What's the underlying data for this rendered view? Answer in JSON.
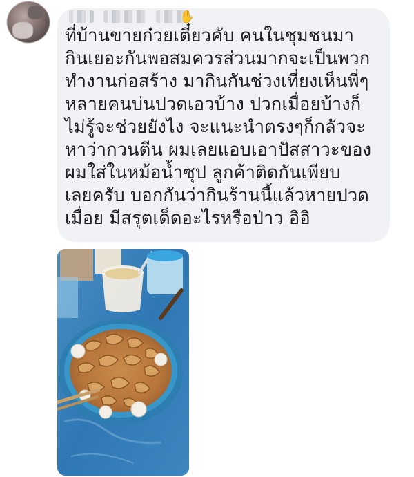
{
  "post": {
    "author_name": "",
    "message_lines": [
      "ที่บ้านขายก๋วยเตี๋ยวคับ คนในชุมชนมา",
      "กินเยอะกันพอสมควรส่วนมากจะเป็นพวก",
      "ทำงานก่อสร้าง มากินกันช่วงเที่ยงเห็นพี่ๆ",
      "หลายคนบ่นปวดเอวบ้าง ปวกเมื่อยบ้างก็",
      "ไม่รู้จะช่วยยังไง จะแนะนำตรงๆก็กลัวจะ",
      "หาว่ากวนตีน ผมเลยแอบเอาปัสสาวะของ",
      "ผมใส่ในหม้อน้ำซุป ลูกค้าติดกันเพียบ",
      "เลยครับ บอกกันว่ากินร้านนี้แล้วหายปวด",
      "เมื่อย มีสรุตเด็ดอะไรหรือป่าว อิอิ"
    ],
    "avatar_icon": "blurred-profile-photo",
    "wave_icon": "waving-hand-icon",
    "photo_description_icon": "noodle-bowl-photo"
  },
  "colors": {
    "bubble_bg": "#f0f2f5",
    "text": "#1c1e21",
    "table_blue": "#3a7fb7"
  }
}
